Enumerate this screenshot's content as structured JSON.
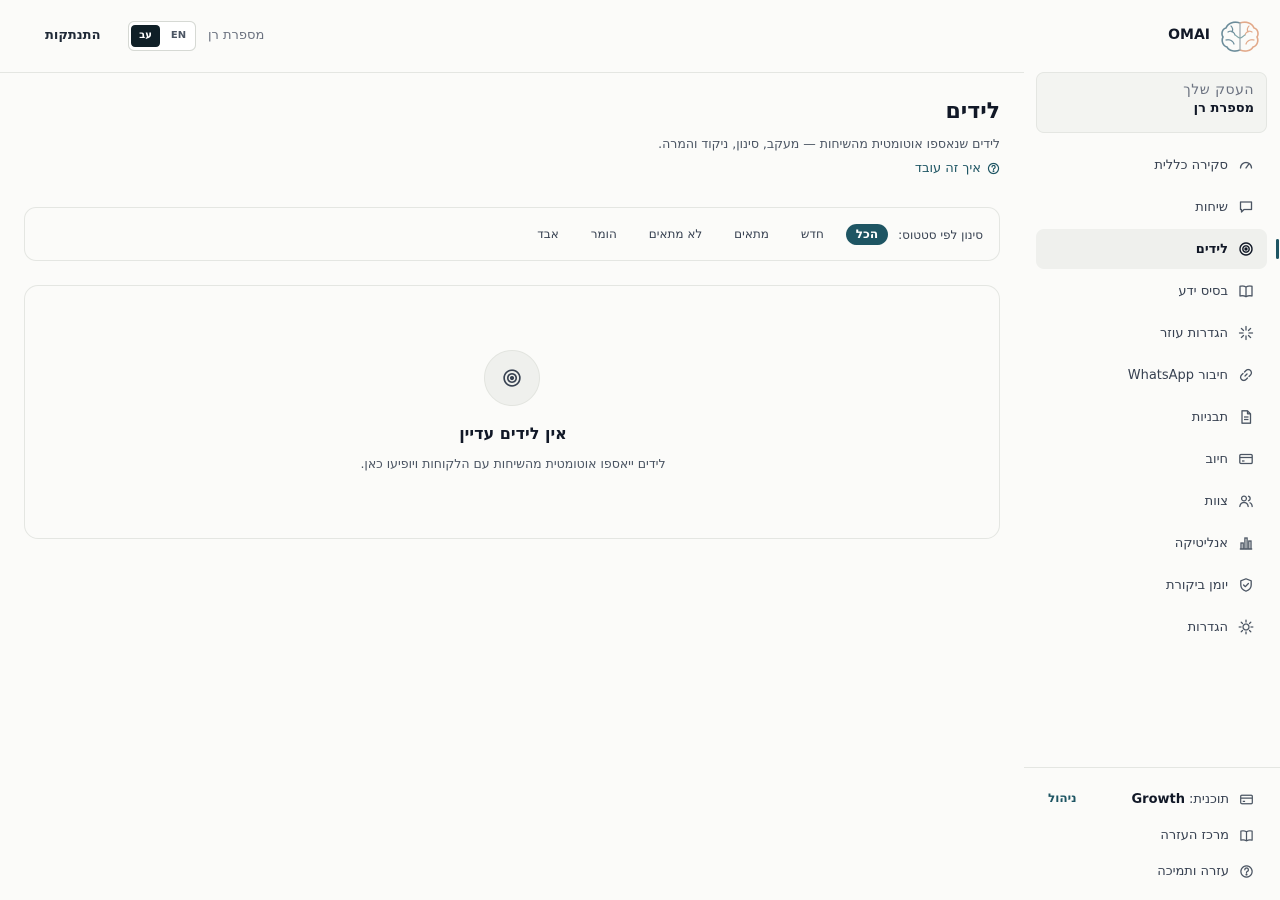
{
  "brand": {
    "name": "OMAI",
    "logo_icon": "brain-icon"
  },
  "business_card": {
    "label": "העסק שלך",
    "name": "מספרת רן"
  },
  "sidebar": {
    "items": [
      {
        "label": "סקירה כללית",
        "icon": "gauge-icon",
        "active": false
      },
      {
        "label": "שיחות",
        "icon": "chat-bubble-icon",
        "active": false
      },
      {
        "label": "לידים",
        "icon": "target-icon",
        "active": true
      },
      {
        "label": "בסיס ידע",
        "icon": "book-open-icon",
        "active": false
      },
      {
        "label": "הגדרות עוזר",
        "icon": "sparkle-icon",
        "active": false
      },
      {
        "label": "חיבור WhatsApp",
        "icon": "link-icon",
        "active": false
      },
      {
        "label": "תבניות",
        "icon": "document-icon",
        "active": false
      },
      {
        "label": "חיוב",
        "icon": "credit-card-icon",
        "active": false
      },
      {
        "label": "צוות",
        "icon": "users-icon",
        "active": false
      },
      {
        "label": "אנליטיקה",
        "icon": "bar-chart-icon",
        "active": false
      },
      {
        "label": "יומן ביקורת",
        "icon": "shield-check-icon",
        "active": false
      },
      {
        "label": "הגדרות",
        "icon": "sun-gear-icon",
        "active": false
      }
    ],
    "plan_label": "תוכנית:",
    "plan_value": "Growth",
    "manage_label": "ניהול",
    "help_center_label": "מרכז העזרה",
    "support_label": "עזרה ותמיכה"
  },
  "header": {
    "logout_label": "התנתקות",
    "lang_he": "עב",
    "lang_en": "EN",
    "business_name": "מספרת רן"
  },
  "main": {
    "title": "לידים",
    "subtitle": "לידים שנאספו אוטומטית מהשיחות — מעקב, סינון, ניקוד והמרה.",
    "how_it_works": "איך זה עובד",
    "filter": {
      "label": "סינון לפי סטטוס:",
      "chips": [
        {
          "label": "הכל",
          "active": true
        },
        {
          "label": "חדש",
          "active": false
        },
        {
          "label": "מתאים",
          "active": false
        },
        {
          "label": "לא מתאים",
          "active": false
        },
        {
          "label": "הומר",
          "active": false
        },
        {
          "label": "אבד",
          "active": false
        }
      ]
    },
    "empty": {
      "title": "אין לידים עדיין",
      "description": "לידים ייאספו אוטומטית מהשיחות עם הלקוחות ויופיעו כאן."
    }
  },
  "colors": {
    "accent": "#1e5563",
    "lang_active_bg": "#0f1f27",
    "background": "#fbfbf9"
  }
}
